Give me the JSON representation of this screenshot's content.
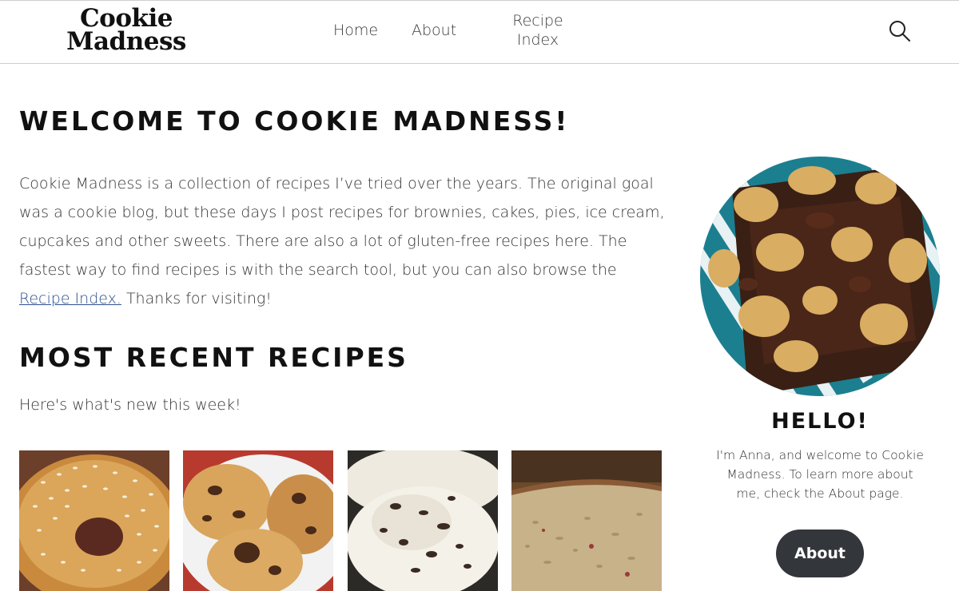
{
  "header": {
    "logo_line1": "Cookie",
    "logo_line2": "Madness",
    "nav": {
      "home": "Home",
      "about": "About",
      "recipe_index_line1": "Recipe",
      "recipe_index_line2": "Index"
    },
    "search_icon": "search-icon"
  },
  "main": {
    "welcome_title": "WELCOME TO COOKIE MADNESS!",
    "intro_before_link": "Cookie Madness is a collection of recipes I’ve tried over the years. The original goal was a cookie blog, but these days I post recipes for brownies, cakes, pies, ice cream, cupcakes and other sweets. There are also a lot of gluten-free recipes here. The fastest way to find recipes is with the search tool, but you can also browse the ",
    "intro_link": "Recipe Index.",
    "intro_after_link": " Thanks for visiting!",
    "recent_title": "MOST RECENT RECIPES",
    "recent_subtitle": "Here's what's new this week!"
  },
  "sidebar": {
    "hello_title": "HELLO!",
    "hello_text": "I'm Anna, and welcome to Cookie Madness. To learn more about me, check the About page.",
    "about_button": "About"
  },
  "colors": {
    "link": "#2c4f8f",
    "button_bg": "#33363a",
    "header_border": "#cfcfcf"
  }
}
